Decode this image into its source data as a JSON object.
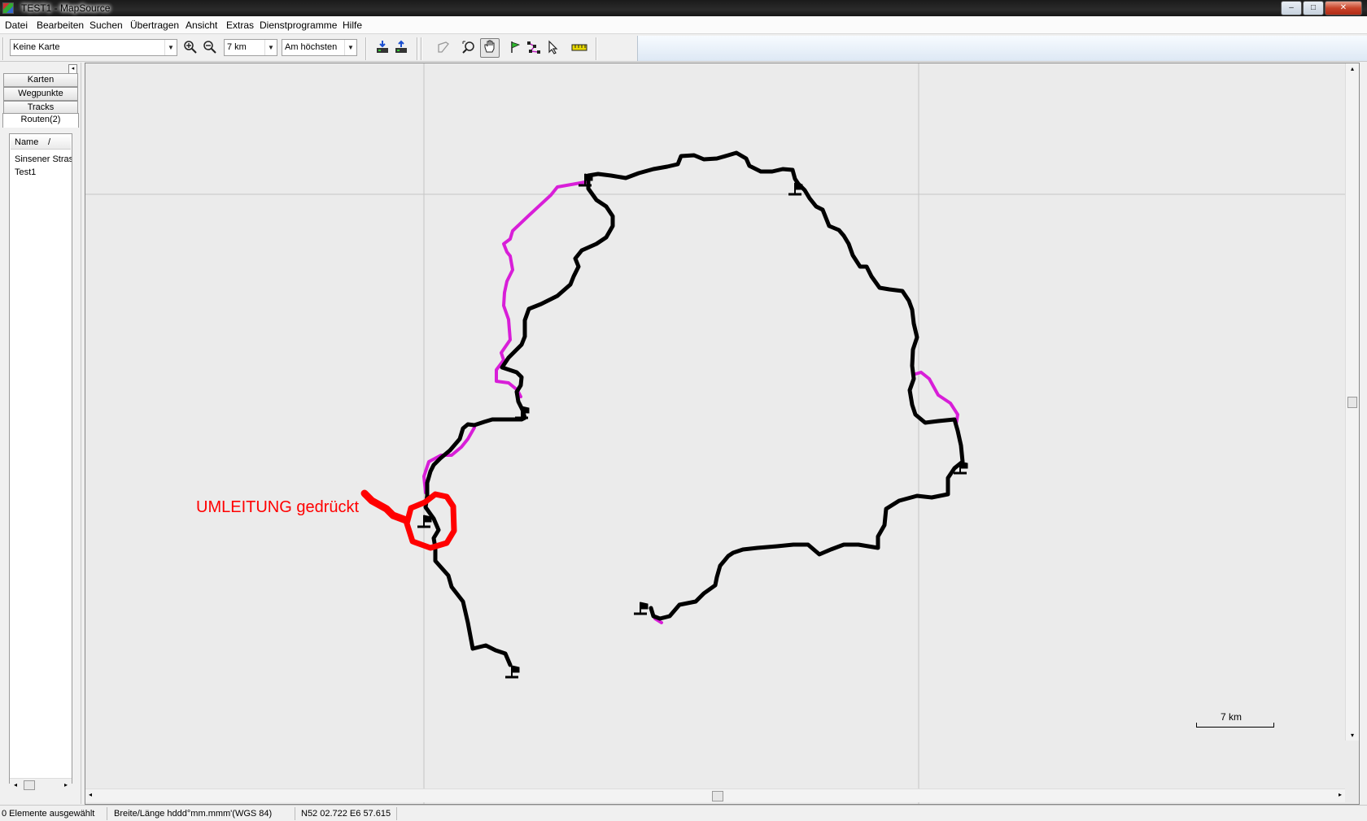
{
  "window": {
    "title": "TEST1 - MapSource",
    "min": "–",
    "max": "□",
    "close": "✕"
  },
  "menu": [
    "Datei",
    "Bearbeiten",
    "Suchen",
    "Übertragen",
    "Ansicht",
    "Extras",
    "Dienstprogramme",
    "Hilfe"
  ],
  "toolbar": {
    "map_select": "Keine Karte",
    "zoom_level": "7 km",
    "detail_level": "Am höchsten",
    "dropdown_arrow": "▼"
  },
  "sidebar": {
    "collapse": "◂",
    "tabs": [
      "Karten",
      "Wegpunkte",
      "Tracks",
      "Routen(2)"
    ],
    "list_header": "Name",
    "sort_indicator": "/",
    "items": [
      "Sinsener Stras",
      "Test1"
    ],
    "scroll_left": "◂",
    "scroll_right": "▸"
  },
  "map": {
    "annotation": "UMLEITUNG gedrückt",
    "scale_label": "7 km",
    "colors": {
      "route": "#000000",
      "alt_route": "#d81ed8",
      "annotation": "#ff0000",
      "grid": "#c6c6c6"
    }
  },
  "scroll_arrows": {
    "up": "▴",
    "down": "▾",
    "left": "◂",
    "right": "▸"
  },
  "status": {
    "selection": "0 Elemente ausgewählt",
    "format": "Breite/Länge hddd°mm.mmm'(WGS 84)",
    "coordinates": "N52 02.722 E6 57.615"
  }
}
